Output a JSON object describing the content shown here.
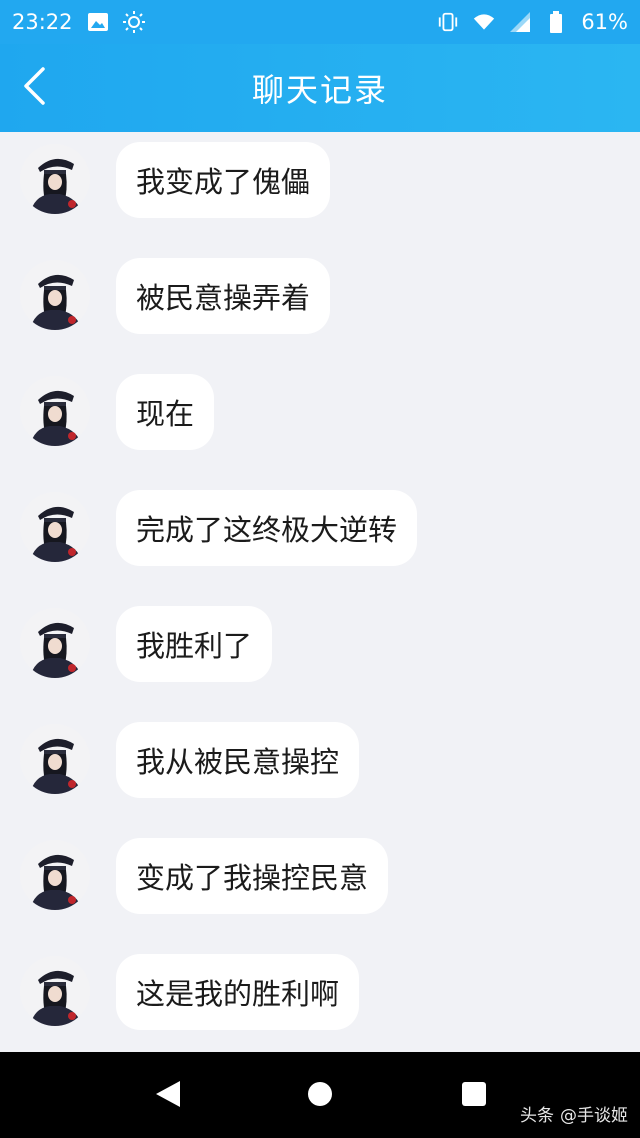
{
  "status_bar": {
    "time": "23:22",
    "battery": "61%",
    "icons_left": [
      "image-icon",
      "brightness-icon"
    ],
    "icons_right": [
      "vibrate-icon",
      "wifi-icon",
      "signal-icon",
      "battery-icon"
    ]
  },
  "header": {
    "title": "聊天记录",
    "back_icon": "chevron-left-icon",
    "color": "#22a8f0"
  },
  "messages": [
    {
      "text": "我变成了傀儡"
    },
    {
      "text": "被民意操弄着"
    },
    {
      "text": "现在"
    },
    {
      "text": "完成了这终极大逆转"
    },
    {
      "text": "我胜利了"
    },
    {
      "text": "我从被民意操控"
    },
    {
      "text": "变成了我操控民意"
    },
    {
      "text": "这是我的胜利啊"
    }
  ],
  "nav_bar": {
    "back": "triangle-back-icon",
    "home": "circle-home-icon",
    "recents": "square-recents-icon"
  },
  "watermark": {
    "prefix": "头条",
    "handle": "@手谈姬"
  }
}
